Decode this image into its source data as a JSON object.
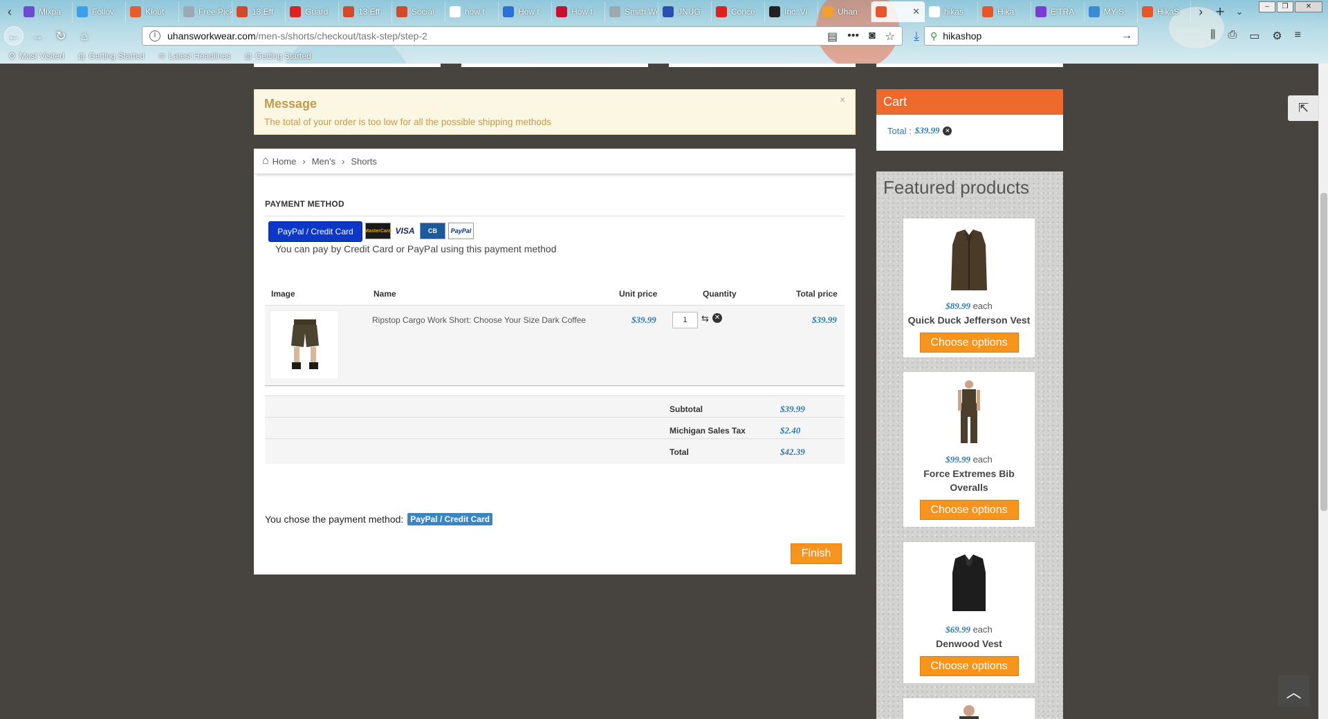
{
  "browser": {
    "tabs": [
      {
        "label": "Mixpa",
        "color": "#6c4bd1"
      },
      {
        "label": "Follov",
        "color": "#3aa0e8"
      },
      {
        "label": "Klout",
        "color": "#e85c2a"
      },
      {
        "label": "Free Pick",
        "color": "#9aa9b2"
      },
      {
        "label": "13 Eff",
        "color": "#d34a2a"
      },
      {
        "label": "Guard",
        "color": "#e02020"
      },
      {
        "label": "13 Eff",
        "color": "#d34a2a"
      },
      {
        "label": "Social",
        "color": "#d34a2a"
      },
      {
        "label": "how t",
        "color": "#ffffff"
      },
      {
        "label": "How t",
        "color": "#2a6fd6"
      },
      {
        "label": "How t",
        "color": "#c8102e"
      },
      {
        "label": "Smith We",
        "color": "#9aa9b2"
      },
      {
        "label": "JNUG",
        "color": "#2a4fb0"
      },
      {
        "label": "Conce",
        "color": "#e02020"
      },
      {
        "label": "Inc. Vi",
        "color": "#222222"
      },
      {
        "label": "Uhan",
        "color": "#f0a030"
      },
      {
        "label": "",
        "color": "#e8552a",
        "active": true
      },
      {
        "label": "hikas",
        "color": "#ffffff"
      },
      {
        "label": "Hika",
        "color": "#e8552a"
      },
      {
        "label": "E'TRA",
        "color": "#7a3bd6"
      },
      {
        "label": "MY S",
        "color": "#3a8ad6"
      },
      {
        "label": "HikaS",
        "color": "#e8552a"
      }
    ],
    "url_host": "uhansworkwear.com",
    "url_path": "/men-s/shorts/checkout/task-step/step-2",
    "search_value": "hikashop",
    "bookmarks": [
      "Most Visited",
      "Getting Started",
      "Latest Headlines",
      "Getting Started"
    ]
  },
  "message": {
    "title": "Message",
    "text": "The total of your order is too low for all the possible shipping methods",
    "close": "×"
  },
  "breadcrumb": [
    "Home",
    "Men's",
    "Shorts"
  ],
  "payment": {
    "title": "PAYMENT METHOD",
    "button": "PayPal / Credit Card",
    "cards": [
      "MasterCard",
      "VISA",
      "CB",
      "PayPal"
    ],
    "description": "You can pay by Credit Card or PayPal using this payment method"
  },
  "cart_table": {
    "headers": [
      "Image",
      "Name",
      "Unit price",
      "Quantity",
      "Total price"
    ],
    "item": {
      "name": "Ripstop Cargo Work Short: Choose Your Size Dark Coffee",
      "unit_price": "$39.99",
      "quantity": "1",
      "total": "$39.99"
    },
    "summary": [
      {
        "label": "Subtotal",
        "value": "$39.99"
      },
      {
        "label": "Michigan Sales Tax",
        "value": "$2.40"
      },
      {
        "label": "Total",
        "value": "$42.39"
      }
    ]
  },
  "chosen": {
    "text": "You chose the payment method:",
    "method": "PayPal / Credit Card"
  },
  "finish_label": "Finish",
  "cart_module": {
    "title": "Cart",
    "total_label": "Total :",
    "total_value": "$39.99"
  },
  "featured": {
    "title": "Featured products",
    "each": "each",
    "option_label": "Choose options",
    "products": [
      {
        "price": "$89.99",
        "name": "Quick Duck Jefferson Vest",
        "color": "#4a3b28"
      },
      {
        "price": "$99.99",
        "name": "Force Extremes Bib Overalls",
        "color": "#4b3f2c"
      },
      {
        "price": "$69.99",
        "name": "Denwood Vest",
        "color": "#1d1d1d"
      }
    ]
  }
}
